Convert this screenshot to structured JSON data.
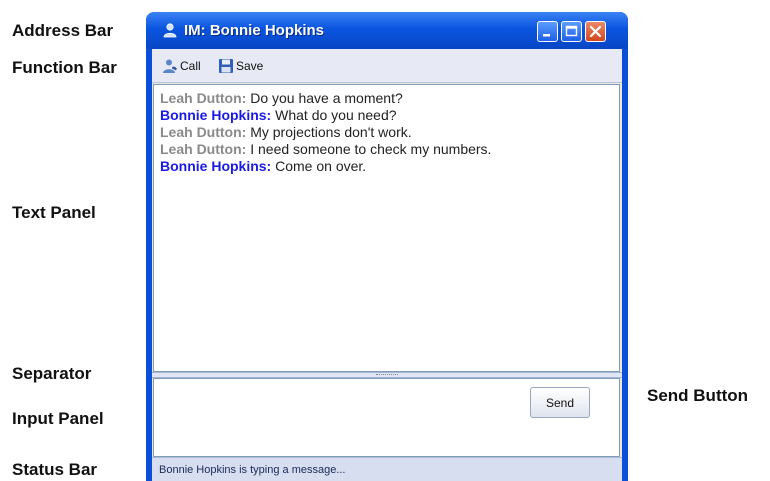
{
  "annotations": {
    "address_bar": "Address Bar",
    "function_bar": "Function Bar",
    "text_panel": "Text Panel",
    "separator": "Separator",
    "input_panel": "Input Panel",
    "status_bar": "Status Bar",
    "send_button": "Send Button"
  },
  "window": {
    "title": "IM: Bonnie Hopkins",
    "title_icon": "person-icon",
    "controls": [
      "minimize",
      "maximize",
      "close"
    ]
  },
  "toolbar": {
    "call_label": "Call",
    "call_icon": "phone-icon",
    "save_label": "Save",
    "save_icon": "floppy-disk-icon"
  },
  "conversation": [
    {
      "sender": "Leah Dutton:",
      "text": " Do you have a moment?",
      "style": "leah"
    },
    {
      "sender": "Bonnie Hopkins:",
      "text": " What do you need?",
      "style": "bonnie"
    },
    {
      "sender": "Leah Dutton:",
      "text": " My projections don't work.",
      "style": "leah"
    },
    {
      "sender": "Leah Dutton:",
      "text": " I need someone to check my numbers.",
      "style": "leah"
    },
    {
      "sender": "Bonnie Hopkins:",
      "text": " Come on over.",
      "style": "bonnie"
    }
  ],
  "input": {
    "value": "",
    "send_label": "Send"
  },
  "status": {
    "text": "Bonnie Hopkins is typing a message..."
  },
  "colors": {
    "title_bar": "#0a55e0",
    "sender_leah": "#8a8a8a",
    "sender_bonnie": "#1a1ae8"
  }
}
